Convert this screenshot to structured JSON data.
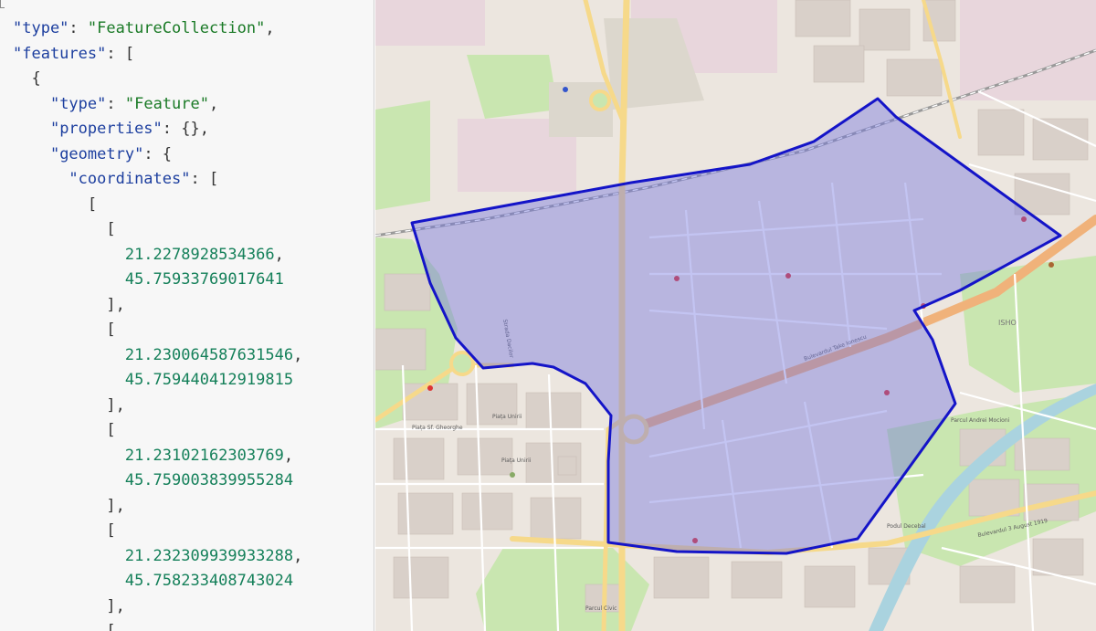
{
  "editor": {
    "lines": [
      [
        {
          "t": "\"type\"",
          "c": "k"
        },
        {
          "t": ": ",
          "c": "p"
        },
        {
          "t": "\"FeatureCollection\"",
          "c": "s"
        },
        {
          "t": ",",
          "c": "p"
        }
      ],
      [
        {
          "t": "\"features\"",
          "c": "k"
        },
        {
          "t": ": [",
          "c": "p"
        }
      ],
      [
        {
          "t": "  {",
          "c": "p"
        }
      ],
      [
        {
          "t": "    ",
          "c": "p"
        },
        {
          "t": "\"type\"",
          "c": "k"
        },
        {
          "t": ": ",
          "c": "p"
        },
        {
          "t": "\"Feature\"",
          "c": "s"
        },
        {
          "t": ",",
          "c": "p"
        }
      ],
      [
        {
          "t": "    ",
          "c": "p"
        },
        {
          "t": "\"properties\"",
          "c": "k"
        },
        {
          "t": ": {},",
          "c": "p"
        }
      ],
      [
        {
          "t": "    ",
          "c": "p"
        },
        {
          "t": "\"geometry\"",
          "c": "k"
        },
        {
          "t": ": {",
          "c": "p"
        }
      ],
      [
        {
          "t": "      ",
          "c": "p"
        },
        {
          "t": "\"coordinates\"",
          "c": "k"
        },
        {
          "t": ": [",
          "c": "p"
        }
      ],
      [
        {
          "t": "        [",
          "c": "p"
        }
      ],
      [
        {
          "t": "          [",
          "c": "p"
        }
      ],
      [
        {
          "t": "            ",
          "c": "p"
        },
        {
          "t": "21.2278928534366",
          "c": "n"
        },
        {
          "t": ",",
          "c": "p"
        }
      ],
      [
        {
          "t": "            ",
          "c": "p"
        },
        {
          "t": "45.75933769017641",
          "c": "n"
        }
      ],
      [
        {
          "t": "          ],",
          "c": "p"
        }
      ],
      [
        {
          "t": "          [",
          "c": "p"
        }
      ],
      [
        {
          "t": "            ",
          "c": "p"
        },
        {
          "t": "21.230064587631546",
          "c": "n"
        },
        {
          "t": ",",
          "c": "p"
        }
      ],
      [
        {
          "t": "            ",
          "c": "p"
        },
        {
          "t": "45.759440412919815",
          "c": "n"
        }
      ],
      [
        {
          "t": "          ],",
          "c": "p"
        }
      ],
      [
        {
          "t": "          [",
          "c": "p"
        }
      ],
      [
        {
          "t": "            ",
          "c": "p"
        },
        {
          "t": "21.23102162303769",
          "c": "n"
        },
        {
          "t": ",",
          "c": "p"
        }
      ],
      [
        {
          "t": "            ",
          "c": "p"
        },
        {
          "t": "45.759003839955284",
          "c": "n"
        }
      ],
      [
        {
          "t": "          ],",
          "c": "p"
        }
      ],
      [
        {
          "t": "          [",
          "c": "p"
        }
      ],
      [
        {
          "t": "            ",
          "c": "p"
        },
        {
          "t": "21.232309939933288",
          "c": "n"
        },
        {
          "t": ",",
          "c": "p"
        }
      ],
      [
        {
          "t": "            ",
          "c": "p"
        },
        {
          "t": "45.758233408743024",
          "c": "n"
        }
      ],
      [
        {
          "t": "          ],",
          "c": "p"
        }
      ],
      [
        {
          "t": "          [",
          "c": "p"
        }
      ]
    ]
  },
  "map": {
    "labels": {
      "piata_unirii": "Piața Unirii",
      "piata_unirii_2": "Piața Unirii",
      "piata_sf_gheorghe": "Piața Sf. Gheorghe",
      "bd_tudor": "Bulevardul Take Ionescu",
      "parcul": "Parcul Civic",
      "strada_dacilor": "Strada Dacilor",
      "bv_3_august": "Bulevardul 3 August 1919",
      "isho": "ISHO",
      "parcul_andrei": "Parcul Andrei Mocioni",
      "podul": "Podul Decebal"
    },
    "colors": {
      "polygon_fill": "#6f73e0",
      "polygon_stroke": "#1414c8",
      "background": "#ece6df",
      "park": "#c9e6b0",
      "canal": "#aad3df"
    }
  }
}
